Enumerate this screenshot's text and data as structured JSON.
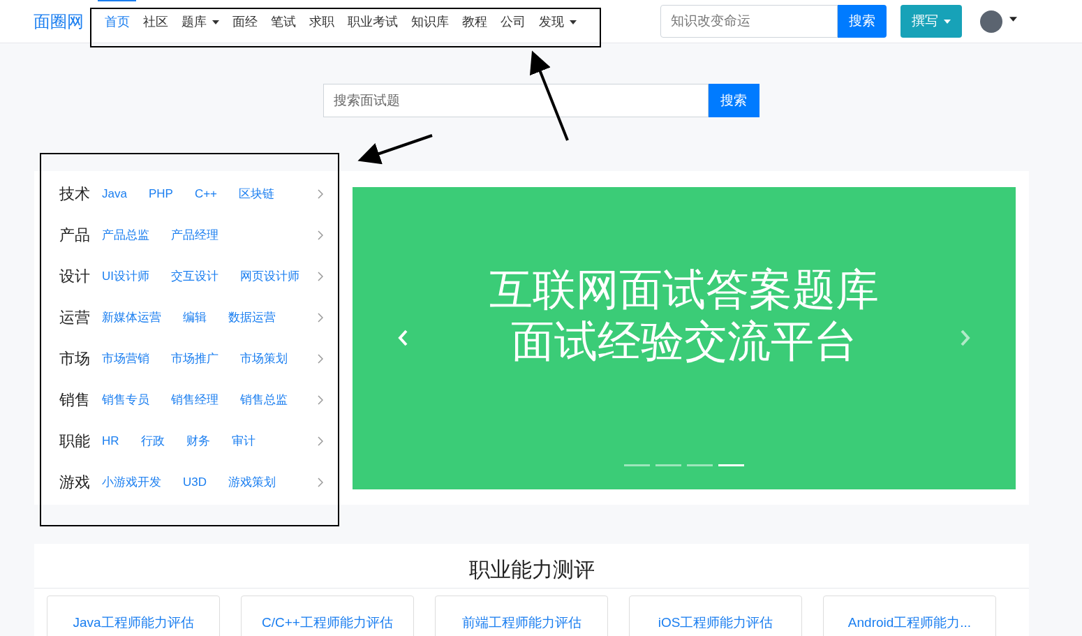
{
  "header": {
    "logo": "面圈网",
    "nav": [
      {
        "label": "首页",
        "selected": true,
        "dropdown": false
      },
      {
        "label": "社区",
        "selected": false,
        "dropdown": false
      },
      {
        "label": "题库",
        "selected": false,
        "dropdown": true
      },
      {
        "label": "面经",
        "selected": false,
        "dropdown": false
      },
      {
        "label": "笔试",
        "selected": false,
        "dropdown": false
      },
      {
        "label": "求职",
        "selected": false,
        "dropdown": false
      },
      {
        "label": "职业考试",
        "selected": false,
        "dropdown": false
      },
      {
        "label": "知识库",
        "selected": false,
        "dropdown": false
      },
      {
        "label": "教程",
        "selected": false,
        "dropdown": false
      },
      {
        "label": "公司",
        "selected": false,
        "dropdown": false
      },
      {
        "label": "发现",
        "selected": false,
        "dropdown": true
      }
    ],
    "search": {
      "placeholder": "知识改变命运",
      "button": "搜索"
    },
    "write_button": "撰写"
  },
  "main_search": {
    "placeholder": "搜索面试题",
    "button": "搜索"
  },
  "categories": [
    {
      "name": "技术",
      "links": [
        "Java",
        "PHP",
        "C++",
        "区块链"
      ]
    },
    {
      "name": "产品",
      "links": [
        "产品总监",
        "产品经理"
      ]
    },
    {
      "name": "设计",
      "links": [
        "UI设计师",
        "交互设计",
        "网页设计师"
      ]
    },
    {
      "name": "运营",
      "links": [
        "新媒体运营",
        "编辑",
        "数据运营"
      ]
    },
    {
      "name": "市场",
      "links": [
        "市场营销",
        "市场推广",
        "市场策划"
      ]
    },
    {
      "name": "销售",
      "links": [
        "销售专员",
        "销售经理",
        "销售总监"
      ]
    },
    {
      "name": "职能",
      "links": [
        "HR",
        "行政",
        "财务",
        "审计"
      ]
    },
    {
      "name": "游戏",
      "links": [
        "小游戏开发",
        "U3D",
        "游戏策划"
      ]
    }
  ],
  "carousel": {
    "lines": [
      "互联网面试答案题库",
      "面试经验交流平台"
    ],
    "indicators": [
      {
        "selected": false
      },
      {
        "selected": false
      },
      {
        "selected": false
      },
      {
        "selected": true
      }
    ]
  },
  "assessment": {
    "title": "职业能力测评",
    "cards": [
      "Java工程师能力评估",
      "C/C++工程师能力评估",
      "前端工程师能力评估",
      "iOS工程师能力评估",
      "Android工程师能力..."
    ]
  }
}
